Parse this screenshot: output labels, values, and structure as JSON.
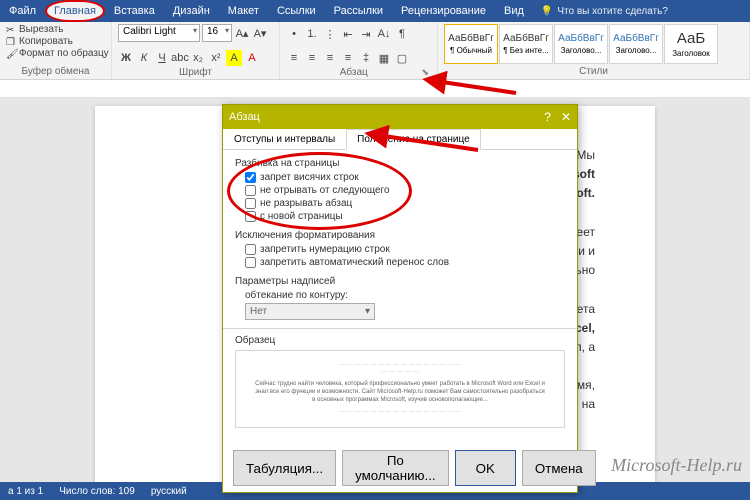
{
  "tabs": {
    "file": "Файл",
    "home": "Главная",
    "insert": "Вставка",
    "design": "Дизайн",
    "layout": "Макет",
    "refs": "Ссылки",
    "mail": "Рассылки",
    "review": "Рецензирование",
    "view": "Вид",
    "tellme": "Что вы хотите сделать?"
  },
  "clipboard": {
    "cut": "Вырезать",
    "copy": "Копировать",
    "painter": "Формат по образцу",
    "label": "Буфер обмена"
  },
  "font": {
    "name": "Calibri Light",
    "size": "16",
    "label": "Шрифт"
  },
  "para": {
    "label": "Абзац"
  },
  "styles": {
    "label": "Стили",
    "preview": "АаБбВвГг",
    "bigpreview": "АаБ",
    "s1": "¶ Обычный",
    "s2": "¶ Без инте...",
    "s3": "Заголово...",
    "s4": "Заголово...",
    "s5": "Заголовок"
  },
  "doc": {
    "l1": ". Мы",
    "l2": "Microsoft",
    "l3": "Microsoft.",
    "l4": "ально умеет",
    "l5": "кции и",
    "l6": "эстоятельно",
    "l7": "пакета",
    "l8": "rd или Excel,",
    "l9": "и сил, а",
    "l10": "омить время,",
    "l11": "годится на"
  },
  "dialog": {
    "title": "Абзац",
    "tab1": "Отступы и интервалы",
    "tab2": "Положение на странице",
    "sec_pag": "Разбивка на страницы",
    "c1": "запрет висячих строк",
    "c2": "не отрывать от следующего",
    "c3": "не разрывать абзац",
    "c4": "с новой страницы",
    "sec_fmt": "Исключения форматирования",
    "c5": "запретить нумерацию строк",
    "c6": "запретить автоматический перенос слов",
    "sec_txt": "Параметры надписей",
    "wrap_label": "обтекание по контуру:",
    "wrap_val": "Нет",
    "sample": "Образец",
    "sample_text": "Сейчас трудно найти человека, который профессионально умеет работать в Microsoft Word или Excel и знал все его функции и возможности. Сайт Microsoft-Help.ru поможет Вам самостоятельно разобраться в основных программах Microsoft, изучив основополагающие...",
    "tabs_btn": "Табуляция...",
    "default_btn": "По умолчанию...",
    "ok": "OK",
    "cancel": "Отмена"
  },
  "status": {
    "page": "а 1 из 1",
    "words": "Число слов: 109",
    "lang": "русский"
  },
  "watermark": "Microsoft-Help.ru"
}
